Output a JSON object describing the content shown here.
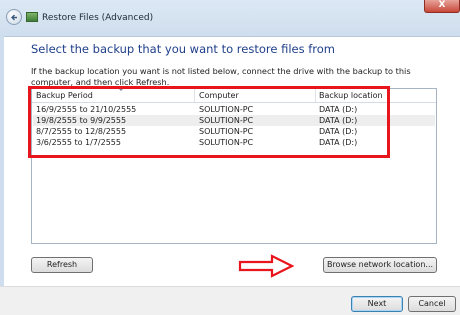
{
  "window": {
    "title": "Restore Files (Advanced)",
    "close_glyph": "X"
  },
  "main": {
    "heading": "Select the backup that you want to restore files from",
    "instructions": "If the backup location you want is not listed below, connect the drive with the backup to this computer, and then click Refresh."
  },
  "table": {
    "columns": [
      "Backup Period",
      "Computer",
      "Backup location"
    ],
    "rows": [
      [
        "16/9/2555 to 21/10/2555",
        "SOLUTION-PC",
        "DATA (D:)"
      ],
      [
        "19/8/2555 to 9/9/2555",
        "SOLUTION-PC",
        "DATA (D:)"
      ],
      [
        "8/7/2555 to 12/8/2555",
        "SOLUTION-PC",
        "DATA (D:)"
      ],
      [
        "3/6/2555 to 1/7/2555",
        "SOLUTION-PC",
        "DATA (D:)"
      ]
    ]
  },
  "buttons": {
    "refresh": "Refresh",
    "browse": "Browse network location...",
    "next": "Next",
    "cancel": "Cancel"
  },
  "annotation": {
    "highlight_color": "#e8161c",
    "arrow_color": "#e8161c"
  },
  "icons": {
    "back": "back-arrow-icon",
    "title": "backup-app-icon",
    "sort": "sort-arrow-icon"
  }
}
